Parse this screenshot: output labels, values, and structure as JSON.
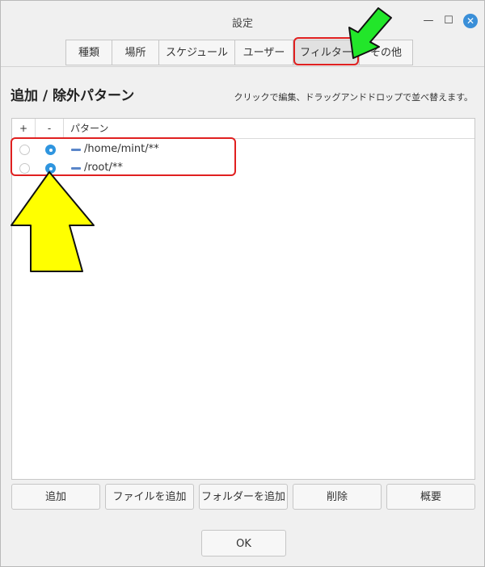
{
  "window": {
    "title": "設定",
    "minimize_icon": "minimize-icon",
    "maximize_icon": "maximize-icon",
    "close_icon": "close-icon",
    "min_glyph": "—",
    "max_glyph": "☐",
    "close_glyph": "✕"
  },
  "tabs": [
    {
      "label": "種類"
    },
    {
      "label": "場所"
    },
    {
      "label": "スケジュール"
    },
    {
      "label": "ユーザー"
    },
    {
      "label": "フィルター"
    },
    {
      "label": "その他"
    }
  ],
  "heading": "追加 / 除外パターン",
  "hint": "クリックで編集、ドラッグアンドドロップで並べ替えます。",
  "table": {
    "col_plus": "+",
    "col_minus": "-",
    "col_pattern": "パターン",
    "rows": [
      {
        "pattern": "/home/mint/**",
        "include": false,
        "exclude": true
      },
      {
        "pattern": "/root/**",
        "include": false,
        "exclude": true
      }
    ]
  },
  "buttons": {
    "add": "追加",
    "add_file": "ファイルを追加",
    "add_folder": "フォルダーを追加",
    "delete": "削除",
    "summary": "概要",
    "ok": "OK"
  },
  "colors": {
    "annotation_red": "#e02020",
    "annotation_green": "#22e62a",
    "annotation_yellow": "#ffff00",
    "accent_blue": "#2f95df"
  }
}
